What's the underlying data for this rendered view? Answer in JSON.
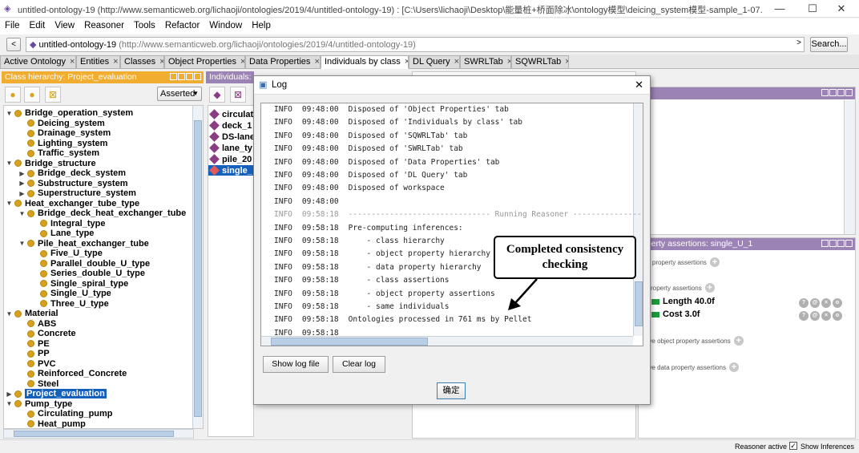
{
  "window": {
    "title": "untitled-ontology-19 (http://www.semanticweb.org/lichaoji/ontologies/2019/4/untitled-ontology-19)  : [C:\\Users\\lichaoji\\Desktop\\能量桩+桥面除冰\\ontology模型\\deicing_system模型-sample_1-07.17-V1.owl]",
    "minimize": "—",
    "maximize": "☐",
    "close": "✕"
  },
  "menu": [
    "File",
    "Edit",
    "View",
    "Reasoner",
    "Tools",
    "Refactor",
    "Window",
    "Help"
  ],
  "address": {
    "back": "<",
    "forward": ">",
    "ontology_name": "untitled-ontology-19",
    "ontology_iri": "(http://www.semanticweb.org/lichaoji/ontologies/2019/4/untitled-ontology-19)",
    "search_label": "Search..."
  },
  "tabs": [
    {
      "label": "Active Ontology",
      "active": false
    },
    {
      "label": "Entities",
      "active": false
    },
    {
      "label": "Classes",
      "active": false
    },
    {
      "label": "Object Properties",
      "active": false
    },
    {
      "label": "Data Properties",
      "active": false
    },
    {
      "label": "Individuals by class",
      "active": true
    },
    {
      "label": "DL Query",
      "active": false
    },
    {
      "label": "SWRLTab",
      "active": false
    },
    {
      "label": "SQWRLTab",
      "active": false
    }
  ],
  "tab_close": "×",
  "class_panel": {
    "title": "Class hierarchy: Project_evaluation",
    "mode": "Asserted",
    "tree": [
      {
        "label": "Bridge_operation_system",
        "level": 1,
        "toggle": "▼"
      },
      {
        "label": "Deicing_system",
        "level": 2,
        "toggle": ""
      },
      {
        "label": "Drainage_system",
        "level": 2,
        "toggle": ""
      },
      {
        "label": "Lighting_system",
        "level": 2,
        "toggle": ""
      },
      {
        "label": "Traffic_system",
        "level": 2,
        "toggle": ""
      },
      {
        "label": "Bridge_structure",
        "level": 1,
        "toggle": "▼"
      },
      {
        "label": "Bridge_deck_system",
        "level": 2,
        "toggle": "▶"
      },
      {
        "label": "Substructure_system",
        "level": 2,
        "toggle": "▶"
      },
      {
        "label": "Superstructure_system",
        "level": 2,
        "toggle": "▶"
      },
      {
        "label": "Heat_exchanger_tube_type",
        "level": 1,
        "toggle": "▼"
      },
      {
        "label": "Bridge_deck_heat_exchanger_tube",
        "level": 2,
        "toggle": "▼"
      },
      {
        "label": "Integral_type",
        "level": 3,
        "toggle": ""
      },
      {
        "label": "Lane_type",
        "level": 3,
        "toggle": ""
      },
      {
        "label": "Pile_heat_exchanger_tube",
        "level": 2,
        "toggle": "▼"
      },
      {
        "label": "Five_U_type",
        "level": 3,
        "toggle": ""
      },
      {
        "label": "Parallel_double_U_type",
        "level": 3,
        "toggle": ""
      },
      {
        "label": "Series_double_U_type",
        "level": 3,
        "toggle": ""
      },
      {
        "label": "Single_spiral_type",
        "level": 3,
        "toggle": ""
      },
      {
        "label": "Single_U_type",
        "level": 3,
        "toggle": ""
      },
      {
        "label": "Three_U_type",
        "level": 3,
        "toggle": ""
      },
      {
        "label": "Material",
        "level": 1,
        "toggle": "▼"
      },
      {
        "label": "ABS",
        "level": 2,
        "toggle": ""
      },
      {
        "label": "Concrete",
        "level": 2,
        "toggle": ""
      },
      {
        "label": "PE",
        "level": 2,
        "toggle": ""
      },
      {
        "label": "PP",
        "level": 2,
        "toggle": ""
      },
      {
        "label": "PVC",
        "level": 2,
        "toggle": ""
      },
      {
        "label": "Reinforced_Concrete",
        "level": 2,
        "toggle": ""
      },
      {
        "label": "Steel",
        "level": 2,
        "toggle": ""
      },
      {
        "label": "Project_evaluation",
        "level": 1,
        "toggle": "▶",
        "selected": true
      },
      {
        "label": "Pump_type",
        "level": 1,
        "toggle": "▼"
      },
      {
        "label": "Circulating_pump",
        "level": 2,
        "toggle": ""
      },
      {
        "label": "Heat_pump",
        "level": 2,
        "toggle": ""
      }
    ]
  },
  "individuals_panel": {
    "title": "Individuals:",
    "items": [
      {
        "label": "circulat",
        "selected": false
      },
      {
        "label": "deck_1",
        "selected": false
      },
      {
        "label": "DS-lane",
        "selected": false
      },
      {
        "label": "lane_ty",
        "selected": false
      },
      {
        "label": "pile_20",
        "selected": false
      },
      {
        "label": "single_",
        "selected": true
      }
    ]
  },
  "property_panel": {
    "title": "operty assertions: single_U_1",
    "sections": [
      {
        "label": "ect property assertions"
      },
      {
        "label": "a property assertions"
      },
      {
        "label": "ative object property assertions"
      },
      {
        "label": "ative data property assertions"
      }
    ],
    "data_props": [
      {
        "name": "Length",
        "value": "40.0f"
      },
      {
        "name": "Cost",
        "value": "3.0f"
      }
    ],
    "prop_buttons": [
      "?",
      "@",
      "×",
      "o"
    ]
  },
  "log_dialog": {
    "title": "Log",
    "close": "✕",
    "lines": [
      {
        "level": "INFO",
        "time": "09:48:00",
        "msg": "Disposed of 'Object Properties' tab",
        "dim": false
      },
      {
        "level": "INFO",
        "time": "09:48:00",
        "msg": "Disposed of 'Individuals by class' tab",
        "dim": false
      },
      {
        "level": "INFO",
        "time": "09:48:00",
        "msg": "Disposed of 'SQWRLTab' tab",
        "dim": false
      },
      {
        "level": "INFO",
        "time": "09:48:00",
        "msg": "Disposed of 'SWRLTab' tab",
        "dim": false
      },
      {
        "level": "INFO",
        "time": "09:48:00",
        "msg": "Disposed of 'Data Properties' tab",
        "dim": false
      },
      {
        "level": "INFO",
        "time": "09:48:00",
        "msg": "Disposed of 'DL Query' tab",
        "dim": false
      },
      {
        "level": "INFO",
        "time": "09:48:00",
        "msg": "Disposed of workspace",
        "dim": false
      },
      {
        "level": "INFO",
        "time": "09:48:00",
        "msg": "",
        "dim": false
      },
      {
        "level": "INFO",
        "time": "09:58:18",
        "msg": "------------------------------- Running Reasoner -------------------------------",
        "dim": true
      },
      {
        "level": "INFO",
        "time": "09:58:18",
        "msg": "Pre-computing inferences:",
        "dim": false
      },
      {
        "level": "INFO",
        "time": "09:58:18",
        "msg": "    - class hierarchy",
        "dim": false
      },
      {
        "level": "INFO",
        "time": "09:58:18",
        "msg": "    - object property hierarchy",
        "dim": false
      },
      {
        "level": "INFO",
        "time": "09:58:18",
        "msg": "    - data property hierarchy",
        "dim": false
      },
      {
        "level": "INFO",
        "time": "09:58:18",
        "msg": "    - class assertions",
        "dim": false
      },
      {
        "level": "INFO",
        "time": "09:58:18",
        "msg": "    - object property assertions",
        "dim": false
      },
      {
        "level": "INFO",
        "time": "09:58:18",
        "msg": "    - same individuals",
        "dim": false
      },
      {
        "level": "INFO",
        "time": "09:58:18",
        "msg": "Ontologies processed in 761 ms by Pellet",
        "dim": false
      },
      {
        "level": "INFO",
        "time": "09:58:18",
        "msg": "",
        "dim": false
      }
    ],
    "show_log_file": "Show log file",
    "clear_log": "Clear log",
    "ok": "确定"
  },
  "callout": {
    "line1": "Completed consistency",
    "line2": "checking"
  },
  "statusbar": {
    "reasoner": "Reasoner active",
    "show_inferences": "Show Inferences",
    "show_inferences_checked": true
  },
  "colors": {
    "class_header": "#f1ad2f",
    "individual_header": "#9c83b5",
    "class_dot": "#d6a21e",
    "individual_diamond": "#8b3d84",
    "selection": "#1560bd",
    "data_prop_bar": "#1e9c3a"
  }
}
